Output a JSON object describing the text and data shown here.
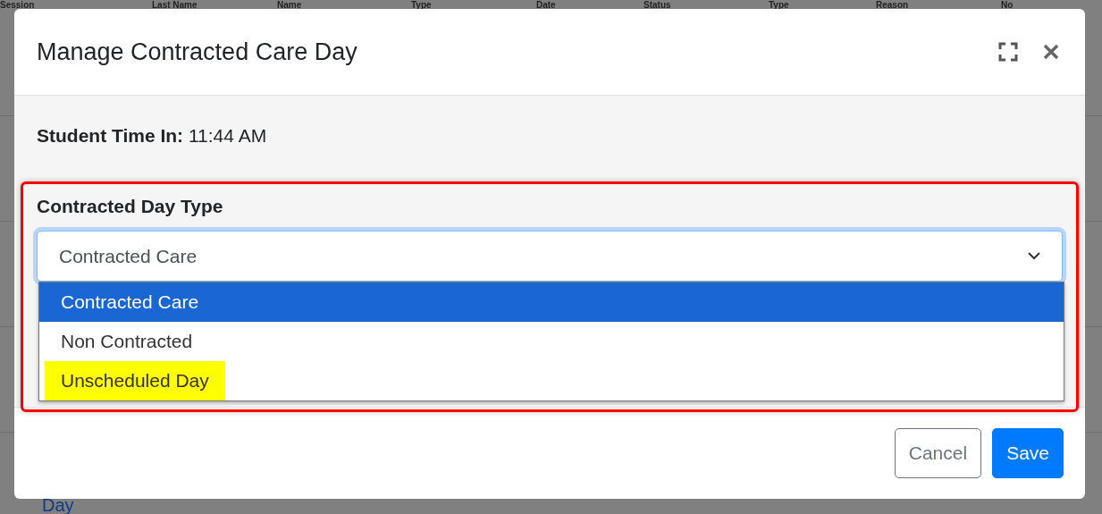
{
  "background_table": {
    "columns": [
      "Session",
      "Last Name",
      "Name",
      "Type",
      "Date",
      "Status",
      "Type",
      "Reason",
      "No"
    ],
    "trailing_text": "Day"
  },
  "modal": {
    "title": "Manage Contracted Care Day",
    "student_time_in": {
      "label": "Student Time In:",
      "value": "11:44 AM"
    },
    "field": {
      "label": "Contracted Day Type",
      "outlined": true,
      "value": "Contracted Care",
      "expanded": true,
      "options": [
        {
          "label": "Contracted Care",
          "selected": true,
          "highlighted": false
        },
        {
          "label": "Non Contracted",
          "selected": false,
          "highlighted": false
        },
        {
          "label": "Unscheduled Day",
          "selected": false,
          "highlighted": true
        }
      ]
    },
    "buttons": [
      {
        "label": "Cancel",
        "kind": "secondary"
      },
      {
        "label": "Save",
        "kind": "primary"
      }
    ]
  }
}
